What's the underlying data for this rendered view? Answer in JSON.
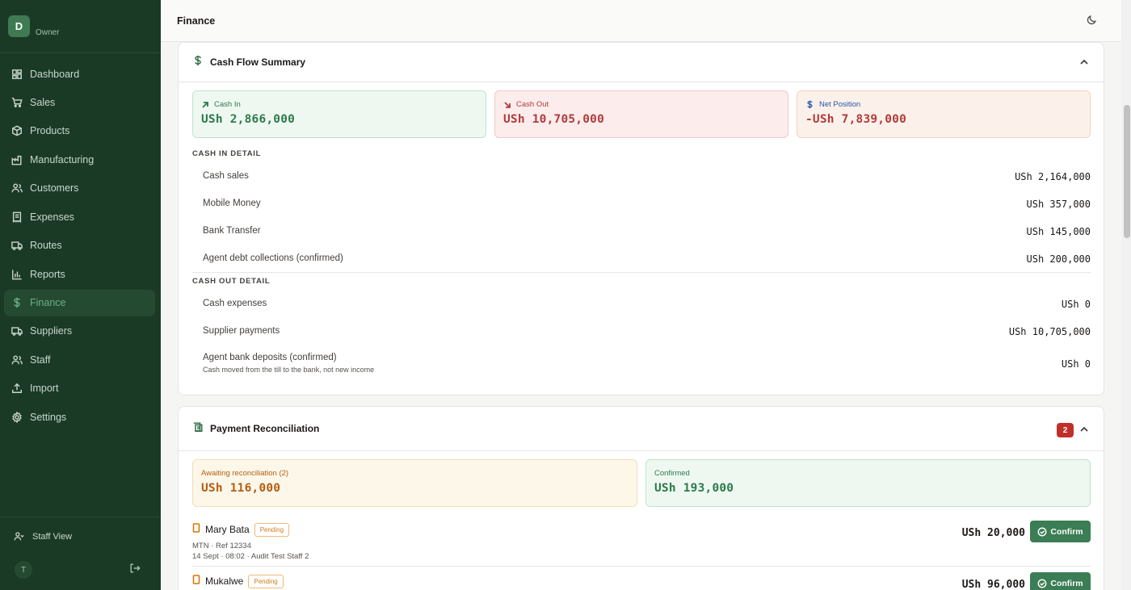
{
  "sidebar": {
    "brand_initial": "D",
    "role": "Owner",
    "items": [
      {
        "label": "Dashboard",
        "icon": "dashboard-icon"
      },
      {
        "label": "Sales",
        "icon": "cart-icon"
      },
      {
        "label": "Products",
        "icon": "box-icon"
      },
      {
        "label": "Manufacturing",
        "icon": "factory-icon"
      },
      {
        "label": "Customers",
        "icon": "users-icon"
      },
      {
        "label": "Expenses",
        "icon": "receipt-icon"
      },
      {
        "label": "Routes",
        "icon": "truck-icon"
      },
      {
        "label": "Reports",
        "icon": "bar-chart-icon"
      },
      {
        "label": "Finance",
        "icon": "dollar-icon",
        "active": true
      },
      {
        "label": "Suppliers",
        "icon": "truck-icon"
      },
      {
        "label": "Staff",
        "icon": "users-icon"
      },
      {
        "label": "Import",
        "icon": "upload-icon"
      },
      {
        "label": "Settings",
        "icon": "gear-icon"
      }
    ],
    "staff_view": "Staff View",
    "user_initial": "T"
  },
  "header": {
    "title": "Finance"
  },
  "cashflow": {
    "title": "Cash Flow Summary",
    "cash_in": {
      "label": "Cash In",
      "value": "USh 2,866,000"
    },
    "cash_out": {
      "label": "Cash Out",
      "value": "USh 10,705,000"
    },
    "net": {
      "label": "Net Position",
      "value": "-USh 7,839,000"
    },
    "in_detail_title": "CASH IN DETAIL",
    "in_rows": [
      {
        "label": "Cash sales",
        "amount": "USh 2,164,000"
      },
      {
        "label": "Mobile Money",
        "amount": "USh 357,000"
      },
      {
        "label": "Bank Transfer",
        "amount": "USh 145,000"
      },
      {
        "label": "Agent debt collections (confirmed)",
        "amount": "USh 200,000"
      }
    ],
    "out_detail_title": "CASH OUT DETAIL",
    "out_rows": [
      {
        "label": "Cash expenses",
        "amount": "USh 0"
      },
      {
        "label": "Supplier payments",
        "amount": "USh 10,705,000"
      },
      {
        "label": "Agent bank deposits (confirmed)",
        "sub": "Cash moved from the till to the bank, not new income",
        "amount": "USh 0"
      }
    ]
  },
  "reconciliation": {
    "title": "Payment Reconciliation",
    "badge": "2",
    "awaiting": {
      "label": "Awaiting reconciliation (2)",
      "value": "USh 116,000"
    },
    "confirmed": {
      "label": "Confirmed",
      "value": "USh 193,000"
    },
    "payments": [
      {
        "name": "Mary Bata",
        "status": "Pending",
        "meta1": "MTN · Ref 12334",
        "meta2": "14 Sept · 08:02 · Audit Test Staff 2",
        "amount": "USh 20,000",
        "button": "Confirm"
      },
      {
        "name": "Mukalwe",
        "status": "Pending",
        "meta1": "",
        "meta2": "",
        "amount": "USh 96,000",
        "button": "Confirm"
      }
    ]
  },
  "colors": {
    "sidebar_bg": "#1b3a26",
    "accent": "#3b7d54",
    "danger": "#b23b3b",
    "positive": "#2d7a4b"
  }
}
